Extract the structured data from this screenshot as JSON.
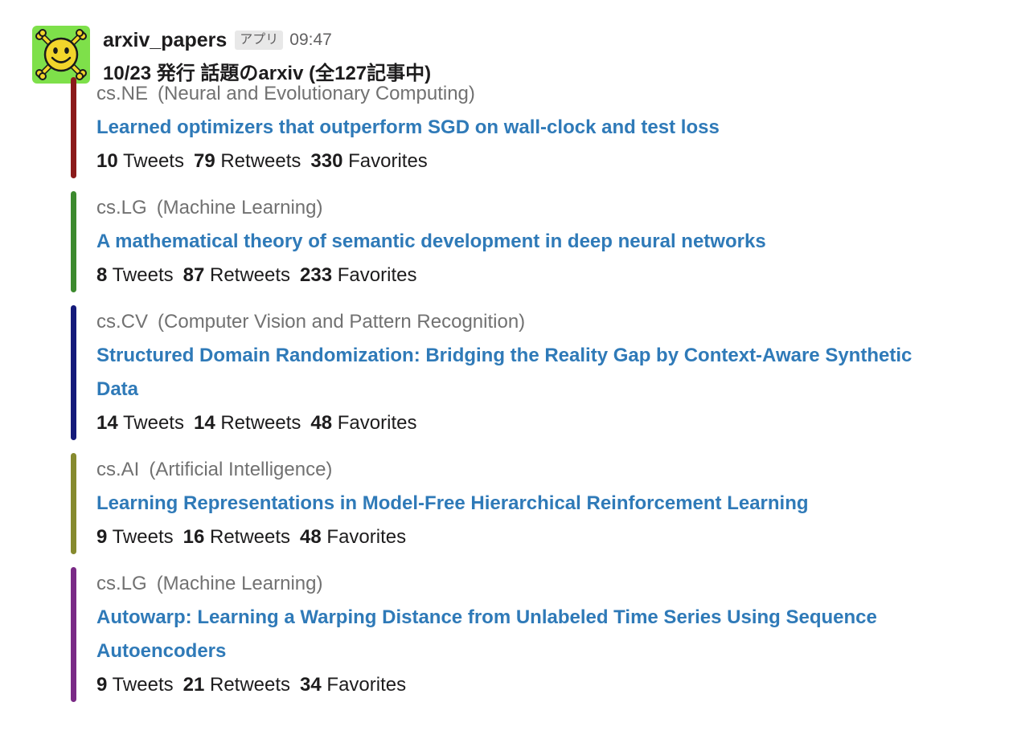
{
  "message": {
    "sender": "arxiv_papers",
    "badge": "アプリ",
    "time": "09:47",
    "headline": "10/23 発行 話題のarxiv (全127記事中)"
  },
  "colors": {
    "link": "#2f7ab8",
    "avatar_bg": "#7ee04a"
  },
  "icons": {
    "avatar": "smiley-crossbones-icon"
  },
  "attachments": [
    {
      "color": "#8b1a1a",
      "category_code": "cs.NE",
      "category_name": "(Neural and Evolutionary Computing)",
      "title": "Learned optimizers that outperform SGD on wall-clock and test loss",
      "tweets": "10",
      "tweets_label": "Tweets",
      "retweets": "79",
      "retweets_label": "Retweets",
      "favorites": "330",
      "favorites_label": "Favorites"
    },
    {
      "color": "#3c8a2e",
      "category_code": "cs.LG",
      "category_name": "(Machine Learning)",
      "title": "A mathematical theory of semantic development in deep neural networks",
      "tweets": "8",
      "tweets_label": "Tweets",
      "retweets": "87",
      "retweets_label": "Retweets",
      "favorites": "233",
      "favorites_label": "Favorites"
    },
    {
      "color": "#141a7a",
      "category_code": "cs.CV",
      "category_name": "(Computer Vision and Pattern Recognition)",
      "title": "Structured Domain Randomization: Bridging the Reality Gap by Context-Aware Synthetic Data",
      "tweets": "14",
      "tweets_label": "Tweets",
      "retweets": "14",
      "retweets_label": "Retweets",
      "favorites": "48",
      "favorites_label": "Favorites"
    },
    {
      "color": "#868a2e",
      "category_code": "cs.AI",
      "category_name": "(Artificial Intelligence)",
      "title": "Learning Representations in Model-Free Hierarchical Reinforcement Learning",
      "tweets": "9",
      "tweets_label": "Tweets",
      "retweets": "16",
      "retweets_label": "Retweets",
      "favorites": "48",
      "favorites_label": "Favorites"
    },
    {
      "color": "#7a2a86",
      "category_code": "cs.LG",
      "category_name": "(Machine Learning)",
      "title": "Autowarp: Learning a Warping Distance from Unlabeled Time Series Using Sequence Autoencoders",
      "tweets": "9",
      "tweets_label": "Tweets",
      "retweets": "21",
      "retweets_label": "Retweets",
      "favorites": "34",
      "favorites_label": "Favorites"
    }
  ]
}
